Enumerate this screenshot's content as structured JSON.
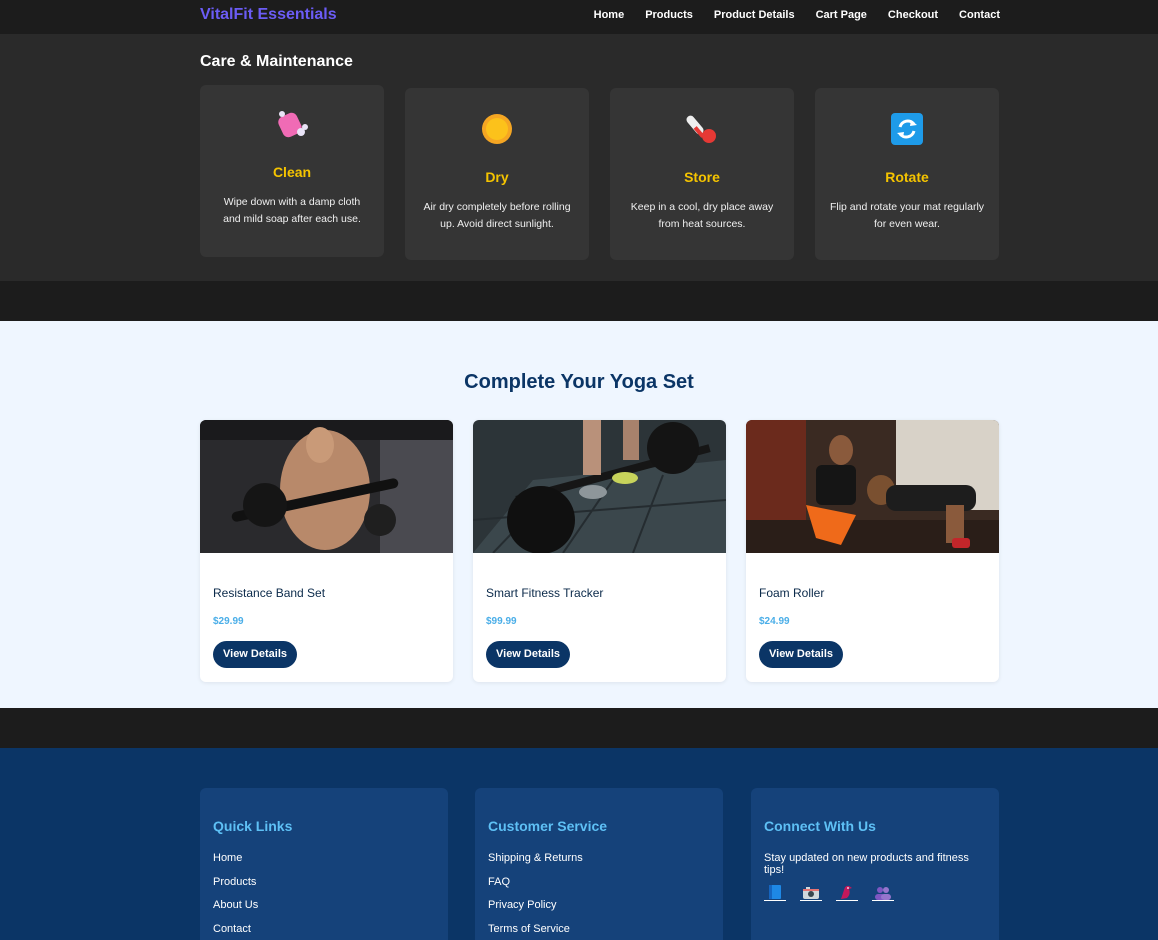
{
  "nav": {
    "brand": "VitalFit Essentials",
    "links": [
      "Home",
      "Products",
      "Product Details",
      "Cart Page",
      "Checkout",
      "Contact"
    ]
  },
  "care": {
    "title": "Care & Maintenance",
    "cards": [
      {
        "icon": "soap-icon",
        "name": "Clean",
        "desc": "Wipe down with a damp cloth and mild soap after each use."
      },
      {
        "icon": "sun-icon",
        "name": "Dry",
        "desc": "Air dry completely before rolling up. Avoid direct sunlight."
      },
      {
        "icon": "thermometer-icon",
        "name": "Store",
        "desc": "Keep in a cool, dry place away from heat sources."
      },
      {
        "icon": "rotate-icon",
        "name": "Rotate",
        "desc": "Flip and rotate your mat regularly for even wear."
      }
    ]
  },
  "set": {
    "title": "Complete Your Yoga Set",
    "products": [
      {
        "name": "Resistance Band Set",
        "price": "$29.99",
        "button": "View Details"
      },
      {
        "name": "Smart Fitness Tracker",
        "price": "$99.99",
        "button": "View Details"
      },
      {
        "name": "Foam Roller",
        "price": "$24.99",
        "button": "View Details"
      }
    ]
  },
  "footer": {
    "quick_links": {
      "title": "Quick Links",
      "items": [
        "Home",
        "Products",
        "About Us",
        "Contact"
      ]
    },
    "customer_service": {
      "title": "Customer Service",
      "items": [
        "Shipping & Returns",
        "FAQ",
        "Privacy Policy",
        "Terms of Service"
      ]
    },
    "connect": {
      "title": "Connect With Us",
      "text": "Stay updated on new products and fitness tips!",
      "icons": [
        "book-icon",
        "camera-icon",
        "bird-icon",
        "people-icon"
      ]
    }
  },
  "colors": {
    "brand": "#6b5cf5",
    "accent": "#f5c400",
    "navy": "#0b3566",
    "price": "#4aaee8"
  }
}
